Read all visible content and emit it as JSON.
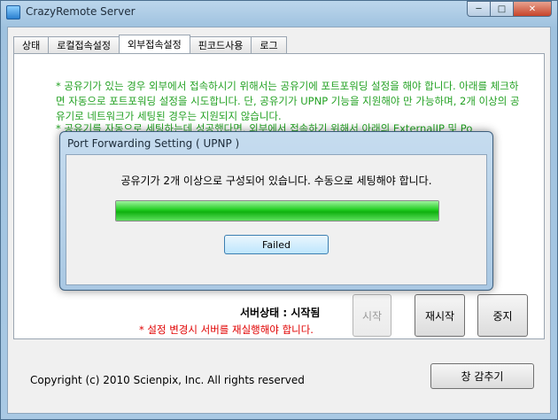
{
  "window": {
    "title": "CrazyRemote Server",
    "buttons": {
      "minimize": "─",
      "maximize": "□",
      "close": "✕"
    }
  },
  "tabs": [
    {
      "label": "상태",
      "active": false
    },
    {
      "label": "로컬접속설정",
      "active": false
    },
    {
      "label": "외부접속설정",
      "active": true
    },
    {
      "label": "핀코드사용",
      "active": false
    },
    {
      "label": "로그",
      "active": false
    }
  ],
  "notes": {
    "note1": "* 공유기가 있는 경우 외부에서 접속하시기 위해서는 공유기에 포트포워딩 설정을 해야 합니다. 아래를 체크하면 자동으로 포트포워딩 설정을 시도합니다. 단, 공유기가 UPNP 기능을 지원해야 만 가능하며, 2개 이상의 공유기로 네트워크가 세팅된 경우는 지원되지 않습니다.",
    "note2": "* 공유기를 자동으로 세팅하는데 성공했다면, 외부에서 접속하기 위해서 아래의 ExternalIP 및 Po"
  },
  "server": {
    "status_label": "서버상태 : 시작됨",
    "restart_note": "* 설정 변경시 서버를 재실행해야 합니다.",
    "start_button": "시작",
    "restart_button": "재시작",
    "stop_button": "중지"
  },
  "footer": {
    "copyright": "Copyright (c) 2010 Scienpix, Inc. All rights reserved",
    "hide_window_button": "창 감추기"
  },
  "dialog": {
    "title": "Port Forwarding Setting ( UPNP )",
    "message": "공유기가 2개 이상으로 구성되어 있습니다. 수동으로 세팅해야 합니다.",
    "progress_percent": 100,
    "button": "Failed"
  },
  "colors": {
    "note_text": "#23a123",
    "warning_text": "#e00000",
    "progress_fill": "#1fcc1f"
  }
}
